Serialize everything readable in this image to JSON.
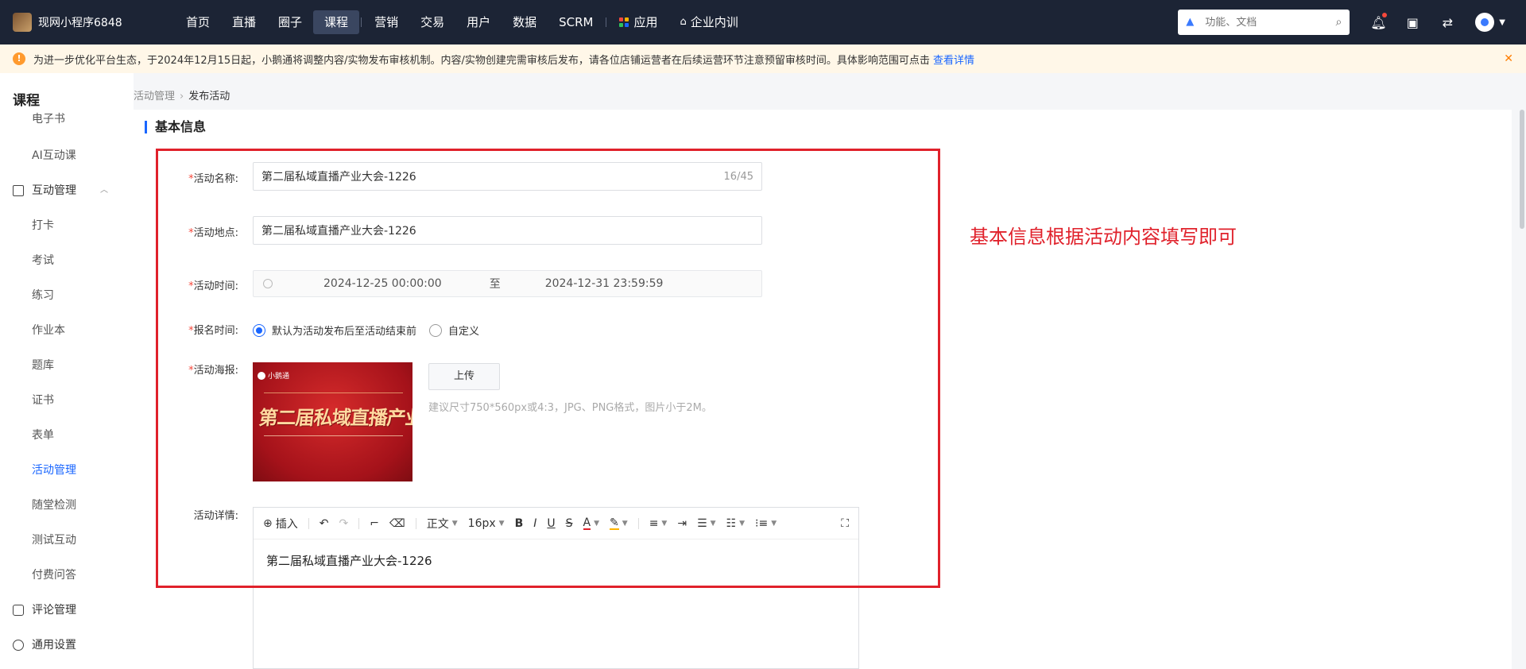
{
  "topbar": {
    "app_name": "现网小程序6848",
    "nav": [
      {
        "label": "首页"
      },
      {
        "label": "直播"
      },
      {
        "label": "圈子"
      },
      {
        "label": "课程"
      },
      {
        "label": "营销"
      },
      {
        "label": "交易"
      },
      {
        "label": "用户"
      },
      {
        "label": "数据"
      },
      {
        "label": "SCRM"
      },
      {
        "label": "应用"
      },
      {
        "label": "企业内训"
      }
    ],
    "active_nav": "课程",
    "search_placeholder": "功能、文档"
  },
  "notice": {
    "text": "为进一步优化平台生态，于2024年12月15日起，小鹅通将调整内容/实物发布审核机制。内容/实物创建完需审核后发布，请各位店铺运营者在后续运营环节注意预留审核时间。具体影响范围可点击",
    "link": "查看详情"
  },
  "sidebar": {
    "title": "课程",
    "items_top": [
      {
        "label": "电子书"
      },
      {
        "label": "AI互动课"
      }
    ],
    "group": "互动管理",
    "items": [
      {
        "label": "打卡"
      },
      {
        "label": "考试"
      },
      {
        "label": "练习"
      },
      {
        "label": "作业本"
      },
      {
        "label": "题库"
      },
      {
        "label": "证书"
      },
      {
        "label": "表单"
      },
      {
        "label": "活动管理"
      },
      {
        "label": "随堂检测"
      },
      {
        "label": "测试互动"
      },
      {
        "label": "付费问答"
      }
    ],
    "active": "活动管理",
    "group2": "评论管理",
    "group3": "通用设置"
  },
  "breadcrumb": {
    "parent": "活动管理",
    "sep": "›",
    "current": "发布活动"
  },
  "section_title": "基本信息",
  "annotation": "基本信息根据活动内容填写即可",
  "form": {
    "required_mark": "*",
    "name_label": "活动名称:",
    "name_value": "第二届私域直播产业大会-1226",
    "name_counter": "16/45",
    "place_label": "活动地点:",
    "place_value": "第二届私域直播产业大会-1226",
    "time_label": "活动时间:",
    "time_start": "2024-12-25 00:00:00",
    "time_to": "至",
    "time_end": "2024-12-31 23:59:59",
    "signup_label": "报名时间:",
    "signup_option1": "默认为活动发布后至活动结束前",
    "signup_option2": "自定义",
    "poster_label": "活动海报:",
    "poster_brand": "小鹅通",
    "poster_title": "第二届私域直播产业大会",
    "upload_label": "上传",
    "upload_hint": "建议尺寸750*560px或4:3，JPG、PNG格式，图片小于2M。",
    "detail_label": "活动详情:"
  },
  "editor": {
    "insert": "插入",
    "style": "正文",
    "font_size": "16px",
    "bold": "B",
    "italic": "I",
    "underline": "U",
    "strike": "S",
    "font_color": "A",
    "content": "第二届私域直播产业大会-1226"
  }
}
